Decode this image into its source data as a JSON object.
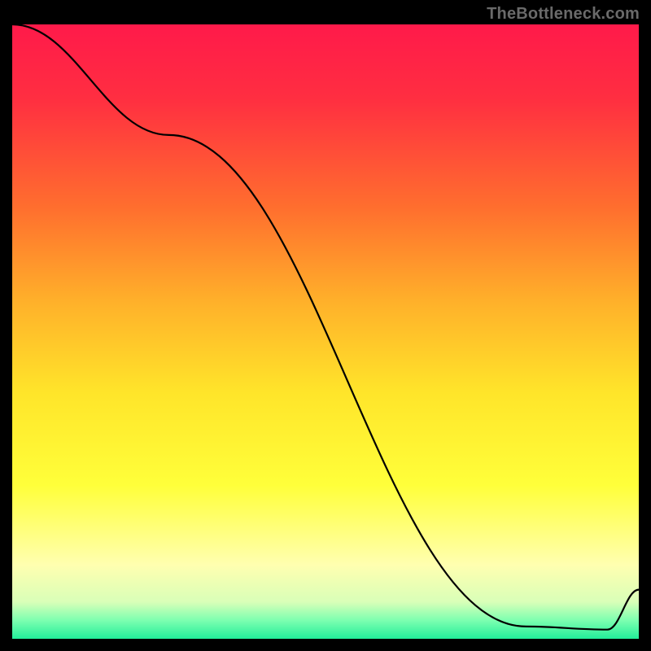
{
  "watermark": "TheBottleneck.com",
  "chart_data": {
    "type": "line",
    "title": "",
    "xlabel": "",
    "ylabel": "",
    "x": [
      0,
      25,
      82,
      95,
      100
    ],
    "values": [
      100,
      82,
      2,
      1.5,
      8
    ],
    "xlim": [
      0,
      100
    ],
    "ylim": [
      0,
      100
    ],
    "background_gradient": {
      "stops": [
        {
          "offset": 0.0,
          "color": "#ff1a4a"
        },
        {
          "offset": 0.12,
          "color": "#ff2e41"
        },
        {
          "offset": 0.3,
          "color": "#ff6f2e"
        },
        {
          "offset": 0.45,
          "color": "#ffb02a"
        },
        {
          "offset": 0.6,
          "color": "#ffe52a"
        },
        {
          "offset": 0.75,
          "color": "#ffff3a"
        },
        {
          "offset": 0.88,
          "color": "#ffffb0"
        },
        {
          "offset": 0.94,
          "color": "#d9ffb8"
        },
        {
          "offset": 0.97,
          "color": "#7dffb0"
        },
        {
          "offset": 1.0,
          "color": "#22ee9a"
        }
      ]
    },
    "legend_text": "",
    "legend_color": "#ff1a24"
  }
}
